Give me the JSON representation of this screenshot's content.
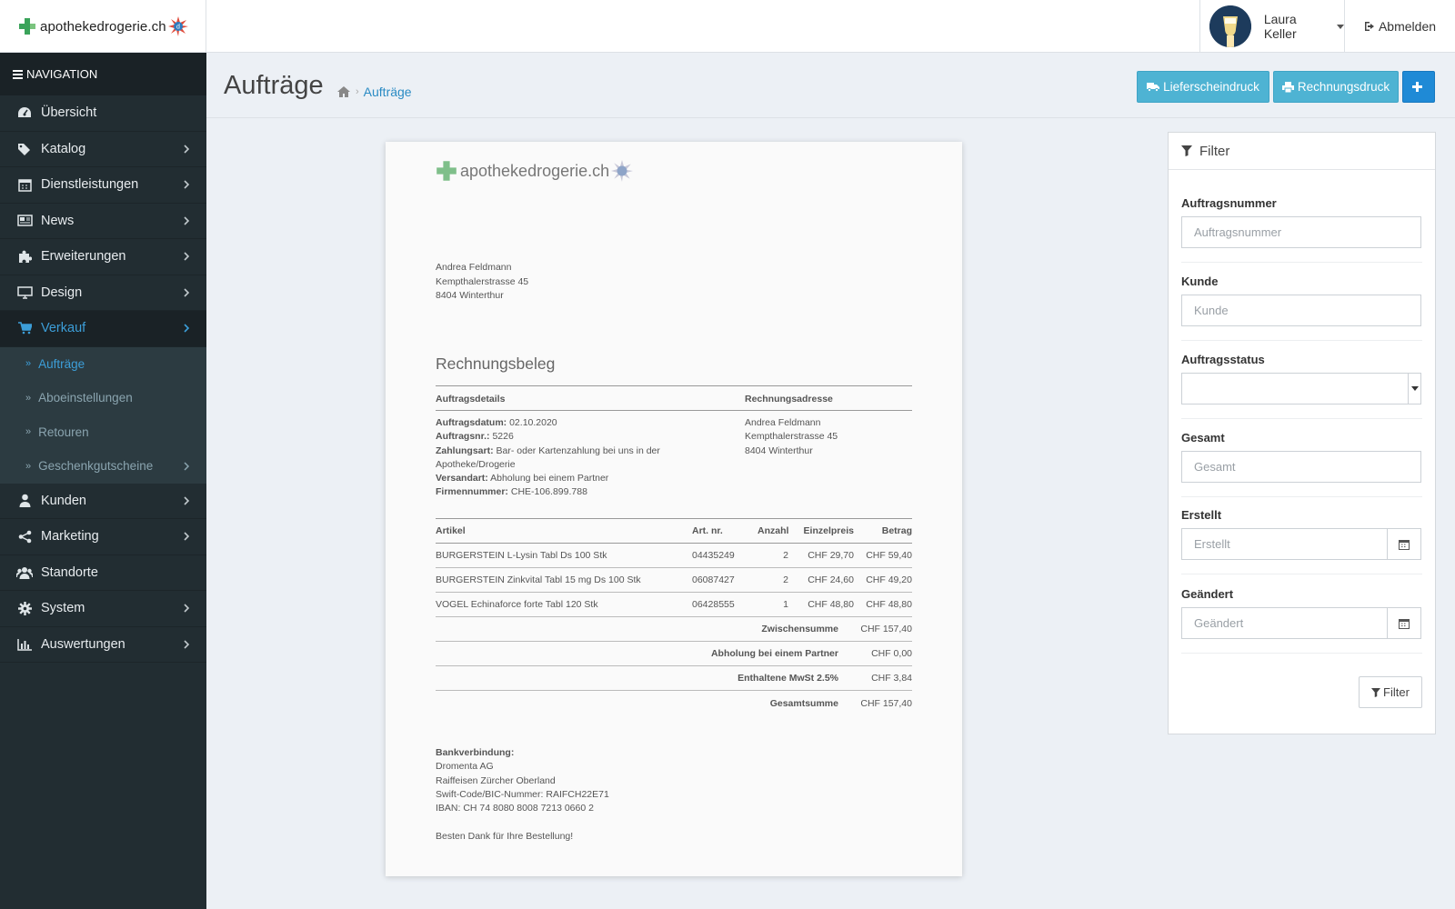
{
  "brand": {
    "name": "apothekedrogerie.ch"
  },
  "header": {
    "user_name": "Laura Keller",
    "logout_label": "Abmelden"
  },
  "sidebar": {
    "header": "NAVIGATION",
    "items": [
      {
        "label": "Übersicht",
        "icon": "dashboard-icon"
      },
      {
        "label": "Katalog",
        "icon": "tags-icon"
      },
      {
        "label": "Dienstleistungen",
        "icon": "calendar-icon"
      },
      {
        "label": "News",
        "icon": "newspaper-icon"
      },
      {
        "label": "Erweiterungen",
        "icon": "puzzle-icon"
      },
      {
        "label": "Design",
        "icon": "desktop-icon"
      },
      {
        "label": "Verkauf",
        "icon": "cart-icon"
      }
    ],
    "sub_items": [
      {
        "label": "Aufträge"
      },
      {
        "label": "Aboeinstellungen"
      },
      {
        "label": "Retouren"
      },
      {
        "label": "Geschenkgutscheine"
      }
    ],
    "items_after": [
      {
        "label": "Kunden",
        "icon": "user-icon"
      },
      {
        "label": "Marketing",
        "icon": "share-icon"
      },
      {
        "label": "Standorte",
        "icon": "users-icon"
      },
      {
        "label": "System",
        "icon": "cog-icon"
      },
      {
        "label": "Auswertungen",
        "icon": "bar-chart-icon"
      }
    ]
  },
  "page": {
    "title": "Aufträge",
    "breadcrumb": "Aufträge",
    "btn_liefer": "Lieferscheindruck",
    "btn_rechnung": "Rechnungsdruck",
    "btn_add": "+"
  },
  "document": {
    "logo": "apothekedrogerie.ch",
    "customer": {
      "name": "Andrea Feldmann",
      "street": "Kempthalerstrasse 45",
      "city": "8404 Winterthur"
    },
    "title": "Rechnungsbeleg",
    "col_details": "Auftragsdetails",
    "col_address": "Rechnungsadresse",
    "details": [
      {
        "label": "Auftragsdatum:",
        "value": "02.10.2020"
      },
      {
        "label": "Auftragsnr.:",
        "value": "5226"
      },
      {
        "label": "Zahlungsart:",
        "value": "Bar- oder Kartenzahlung bei uns in der Apotheke/Drogerie"
      },
      {
        "label": "Versandart:",
        "value": "Abholung bei einem Partner"
      },
      {
        "label": "Firmennummer:",
        "value": "CHE-106.899.788"
      }
    ],
    "table_headers": {
      "art": "Artikel",
      "nr": "Art. nr.",
      "anz": "Anzahl",
      "ep": "Einzelpreis",
      "bt": "Betrag"
    },
    "rows": [
      {
        "art": "BURGERSTEIN L-Lysin Tabl Ds 100 Stk",
        "nr": "04435249",
        "anz": "2",
        "ep": "CHF 29,70",
        "bt": "CHF 59,40"
      },
      {
        "art": "BURGERSTEIN Zinkvital Tabl 15 mg Ds 100 Stk",
        "nr": "06087427",
        "anz": "2",
        "ep": "CHF 24,60",
        "bt": "CHF 49,20"
      },
      {
        "art": "VOGEL Echinaforce forte Tabl 120 Stk",
        "nr": "06428555",
        "anz": "1",
        "ep": "CHF 48,80",
        "bt": "CHF 48,80"
      }
    ],
    "sums": [
      {
        "label": "Zwischensumme",
        "value": "CHF 157,40"
      },
      {
        "label": "Abholung bei einem Partner",
        "value": "CHF 0,00"
      },
      {
        "label": "Enthaltene MwSt 2.5%",
        "value": "CHF 3,84"
      },
      {
        "label": "Gesamtsumme",
        "value": "CHF 157,40"
      }
    ],
    "bank": {
      "title": "Bankverbindung:",
      "lines": [
        "Dromenta AG",
        "Raiffeisen Zürcher Oberland",
        "Swift-Code/BIC-Nummer: RAIFCH22E71",
        "IBAN: CH 74 8080 8008 7213 0660 2"
      ]
    },
    "thanks": "Besten Dank für Ihre Bestellung!"
  },
  "filter": {
    "title": "Filter",
    "fields": {
      "auftragsnummer": {
        "label": "Auftragsnummer",
        "placeholder": "Auftragsnummer"
      },
      "kunde": {
        "label": "Kunde",
        "placeholder": "Kunde"
      },
      "status": {
        "label": "Auftragsstatus",
        "value": ""
      },
      "gesamt": {
        "label": "Gesamt",
        "placeholder": "Gesamt"
      },
      "erstellt": {
        "label": "Erstellt",
        "placeholder": "Erstellt"
      },
      "geaendert": {
        "label": "Geändert",
        "placeholder": "Geändert"
      }
    },
    "button": "Filter"
  },
  "colors": {
    "sidebar": "#222d32",
    "accent": "#3c9ed8",
    "info_button": "#4eb3d3",
    "primary_button": "#1f8ad6"
  }
}
